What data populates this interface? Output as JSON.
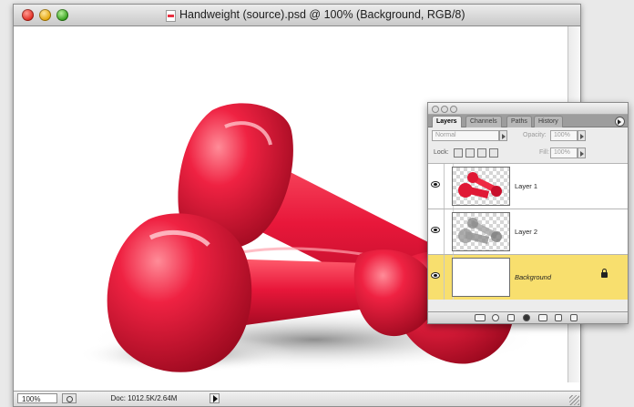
{
  "window": {
    "title": "Handweight (source).psd @ 100% (Background, RGB/8)"
  },
  "status_bar": {
    "zoom": "100%",
    "doc_info": "Doc: 1012.5K/2.64M"
  },
  "layers_panel": {
    "tabs": [
      {
        "label": "Layers",
        "active": true
      },
      {
        "label": "Channels",
        "active": false
      },
      {
        "label": "Paths",
        "active": false
      },
      {
        "label": "History",
        "active": false
      }
    ],
    "blend_mode": "Normal",
    "opacity_label": "Opacity:",
    "opacity_value": "100%",
    "lock_label": "Lock:",
    "fill_label": "Fill:",
    "fill_value": "100%",
    "layers": [
      {
        "name": "Layer 1",
        "visible": true,
        "selected": false
      },
      {
        "name": "Layer 2",
        "visible": true,
        "selected": false
      },
      {
        "name": "Background",
        "visible": true,
        "selected": true,
        "locked": true
      }
    ]
  },
  "colors": {
    "dumbbell_red": "#e8173a",
    "selected_layer": "#f8df6e"
  },
  "icons": [
    "eye-icon",
    "lock-icon",
    "link-icon",
    "fx-icon",
    "mask-icon",
    "adjustment-icon",
    "group-icon",
    "new-layer-icon",
    "trash-icon",
    "palette-menu-icon"
  ]
}
